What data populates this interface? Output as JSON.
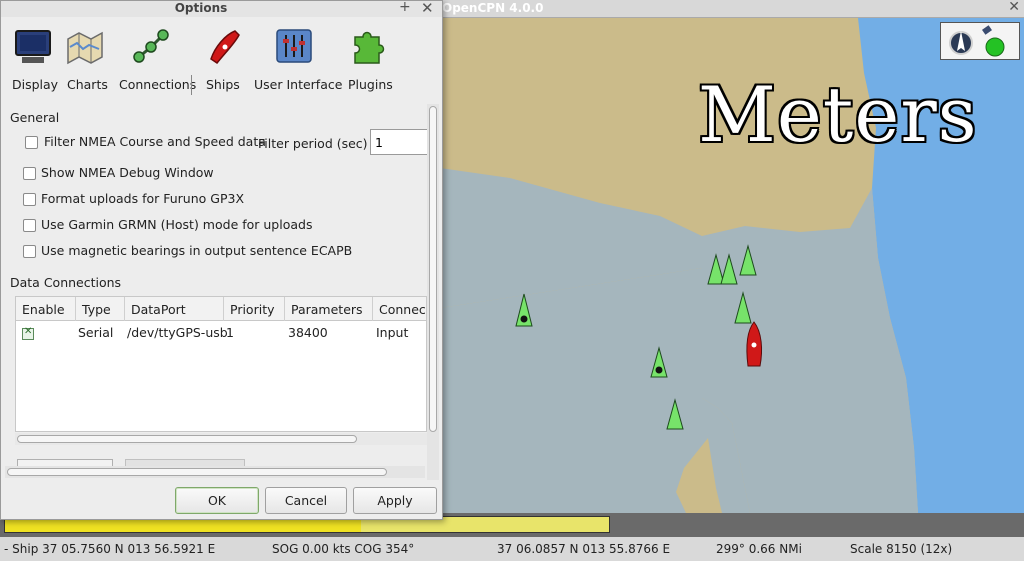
{
  "main_window": {
    "title": "OpenCPN 4.0.0",
    "close_glyph": "✕"
  },
  "chart": {
    "units_banner": "Meters",
    "colors": {
      "land": "#cbbb8a",
      "deep_water": "#72aee6",
      "shallow_water": "#a5b6bd",
      "target": "#77e36a"
    },
    "icons": [
      "compass-icon",
      "gps-status-icon",
      "ais-target-icon",
      "own-ship-icon"
    ]
  },
  "options": {
    "title": "Options",
    "plus_glyph": "+",
    "close_glyph": "✕",
    "toolbar": [
      {
        "label": "Display",
        "icon": "monitor-icon"
      },
      {
        "label": "Charts",
        "icon": "charts-icon"
      },
      {
        "label": "Connections",
        "icon": "connections-icon"
      },
      {
        "label": "Ships",
        "icon": "ship-icon"
      },
      {
        "label": "User Interface",
        "icon": "user-interface-icon"
      },
      {
        "label": "Plugins",
        "icon": "plugin-icon"
      }
    ],
    "general": {
      "heading": "General",
      "filter_nmea": "Filter NMEA Course and Speed data",
      "filter_period_label": "Filter period (sec)",
      "filter_period_value": "1",
      "show_debug": "Show NMEA Debug Window",
      "furuno": "Format uploads for Furuno GP3X",
      "garmin": "Use Garmin GRMN (Host) mode for uploads",
      "magnetic": "Use magnetic bearings in output sentence ECAPB"
    },
    "data_connections": {
      "heading": "Data Connections",
      "columns": [
        "Enable",
        "Type",
        "DataPort",
        "Priority",
        "Parameters",
        "Connect"
      ],
      "rows": [
        {
          "enabled": true,
          "type": "Serial",
          "port": "/dev/ttyGPS-usb",
          "priority": "1",
          "parameters": "38400",
          "connection": "Input"
        }
      ]
    },
    "buttons": {
      "ok": "OK",
      "cancel": "Cancel",
      "apply": "Apply"
    }
  },
  "progress": {
    "fraction": 0.59
  },
  "statusbar": {
    "ship": "- Ship 37 05.7560 N   013 56.5921 E",
    "sog_cog": "SOG 0.00 kts  COG 354°",
    "cursor": "37 06.0857 N   013 55.8766 E",
    "bearing": "299°  0.66 NMi",
    "scale": "Scale 8150 (12x)"
  }
}
